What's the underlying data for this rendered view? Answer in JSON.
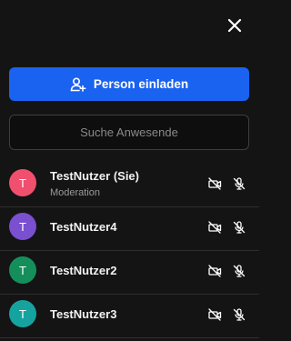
{
  "header": {
    "close_icon": "close-icon"
  },
  "invite": {
    "label": "Person einladen",
    "icon": "add-person-icon"
  },
  "search": {
    "placeholder": "Suche Anwesende",
    "value": ""
  },
  "colors": {
    "background": "#141414",
    "accent": "#1a62f0"
  },
  "participants": [
    {
      "initial": "T",
      "name": "TestNutzer (Sie)",
      "role": "Moderation",
      "avatar_color": "#f0506e",
      "camera": "camera-off-icon",
      "mic": "mic-off-icon"
    },
    {
      "initial": "T",
      "name": "TestNutzer4",
      "role": "",
      "avatar_color": "#7a4fd0",
      "camera": "camera-off-icon",
      "mic": "mic-off-icon"
    },
    {
      "initial": "T",
      "name": "TestNutzer2",
      "role": "",
      "avatar_color": "#148f5b",
      "camera": "camera-off-icon",
      "mic": "mic-off-icon"
    },
    {
      "initial": "T",
      "name": "TestNutzer3",
      "role": "",
      "avatar_color": "#16a3a0",
      "camera": "camera-off-icon",
      "mic": "mic-off-icon"
    }
  ]
}
